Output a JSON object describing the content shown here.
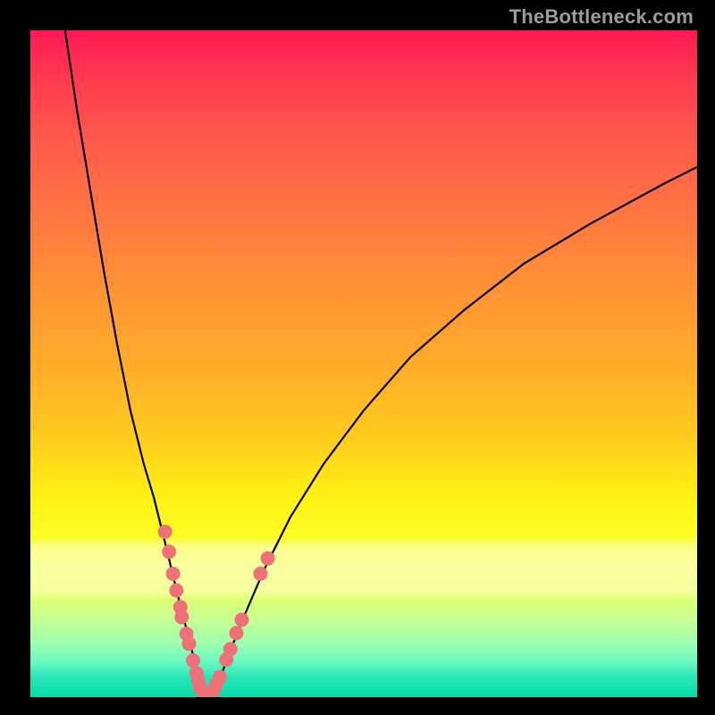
{
  "watermark": "TheBottleneck.com",
  "chart_data": {
    "type": "line",
    "title": "",
    "xlabel": "",
    "ylabel": "",
    "xlim": [
      0,
      100
    ],
    "ylim": [
      0,
      100
    ],
    "series": [
      {
        "name": "left-curve",
        "type": "line",
        "x": [
          5.2,
          7,
          9,
          11,
          13,
          15,
          17,
          18.5,
          20,
          21.2,
          22.3,
          23.2,
          24,
          24.6,
          25.1,
          25.4,
          25.8
        ],
        "y": [
          100,
          88,
          76,
          64,
          53,
          43,
          35,
          30,
          24,
          19,
          14.5,
          11,
          8,
          5.5,
          3.5,
          2,
          0.6
        ]
      },
      {
        "name": "valley-floor",
        "type": "line",
        "x": [
          25.8,
          27.3
        ],
        "y": [
          0.5,
          0.5
        ]
      },
      {
        "name": "right-curve",
        "type": "line",
        "x": [
          27.3,
          28.5,
          30,
          32,
          35,
          39,
          44,
          50,
          57,
          65,
          74,
          84,
          95,
          100
        ],
        "y": [
          0.6,
          3,
          7,
          12,
          19,
          27,
          35,
          43,
          51,
          58,
          65,
          71,
          77,
          79.5
        ]
      }
    ],
    "scatter": {
      "name": "data-points",
      "color": "#f07078",
      "points": [
        {
          "x": 20.2,
          "y": 24.8
        },
        {
          "x": 20.8,
          "y": 21.8
        },
        {
          "x": 21.4,
          "y": 18.5
        },
        {
          "x": 21.9,
          "y": 16.0
        },
        {
          "x": 22.5,
          "y": 13.5
        },
        {
          "x": 22.7,
          "y": 12.0
        },
        {
          "x": 23.4,
          "y": 9.5
        },
        {
          "x": 23.8,
          "y": 8.0
        },
        {
          "x": 24.4,
          "y": 5.5
        },
        {
          "x": 24.9,
          "y": 3.6
        },
        {
          "x": 25.2,
          "y": 2.4
        },
        {
          "x": 25.4,
          "y": 1.5
        },
        {
          "x": 25.9,
          "y": 0.7
        },
        {
          "x": 26.1,
          "y": 0.55
        },
        {
          "x": 26.6,
          "y": 0.5
        },
        {
          "x": 27.1,
          "y": 0.55
        },
        {
          "x": 27.4,
          "y": 0.9
        },
        {
          "x": 27.9,
          "y": 1.9
        },
        {
          "x": 28.4,
          "y": 3.0
        },
        {
          "x": 29.4,
          "y": 5.6
        },
        {
          "x": 30.0,
          "y": 7.2
        },
        {
          "x": 30.9,
          "y": 9.6
        },
        {
          "x": 31.7,
          "y": 11.6
        },
        {
          "x": 34.5,
          "y": 18.5
        },
        {
          "x": 35.6,
          "y": 20.8
        }
      ]
    },
    "background_gradient_stops": [
      {
        "pos": 0.0,
        "color": "#ff1954"
      },
      {
        "pos": 0.3,
        "color": "#ff7c3f"
      },
      {
        "pos": 0.62,
        "color": "#ffcf1c"
      },
      {
        "pos": 0.8,
        "color": "#fbff28"
      },
      {
        "pos": 1.0,
        "color": "#08dca9"
      }
    ],
    "horizontal_pale_band": {
      "y_center": 19.5,
      "height_pct": 9.5
    }
  },
  "colors": {
    "curve": "#000000",
    "points": "#f07078",
    "frame": "#000000",
    "watermark": "#9c9c9c"
  }
}
